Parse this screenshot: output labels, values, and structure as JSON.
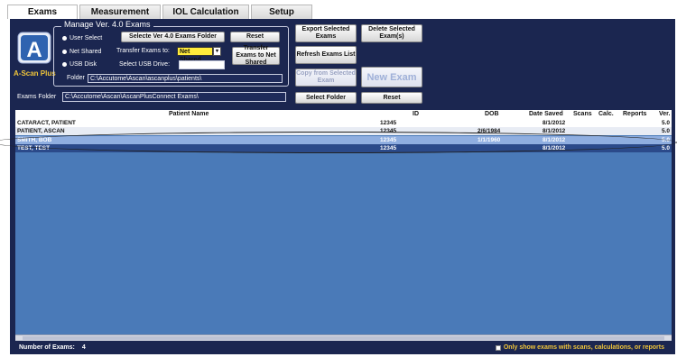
{
  "tabs": [
    "Exams",
    "Measurement",
    "IOL Calculation",
    "Setup"
  ],
  "logo": {
    "label": "A-Scan Plus"
  },
  "manage": {
    "title": "Manage Ver. 4.0 Exams",
    "user_select": "User Select",
    "net_shared": "Net Shared",
    "usb_disk": "USB Disk",
    "select_folder_btn": "Selecte Ver 4.0 Exams Folder",
    "reset_btn": "Reset",
    "transfer_label": "Transfer Exams to:",
    "transfer_value": "Net Shared",
    "transfer_btn": "Transfer Exams to Net Shared",
    "usb_label": "Select USB Drive:",
    "folder_label": "Folder",
    "folder_value": "C:\\Accutome\\Ascan\\ascanplus\\patients\\"
  },
  "actions": {
    "export": "Export Selected Exams",
    "delete": "Delete Selected Exam(s)",
    "refresh": "Refresh Exams List",
    "copy": "Copy from Selected Exam",
    "new_exam": "New Exam"
  },
  "exams_folder": {
    "label": "Exams Folder",
    "value": "C:\\Accutome\\Ascan\\AscanPlusConnect Exams\\",
    "select_btn": "Select Folder",
    "reset_btn": "Reset"
  },
  "table": {
    "headers": [
      "Patient Name",
      "ID",
      "DOB",
      "Date Saved",
      "Scans",
      "Calc.",
      "Reports",
      "Ver."
    ],
    "rows": [
      {
        "name": "CATARACT, PATIENT",
        "id": "12345",
        "dob": "",
        "date": "8/1/2012",
        "ver": "5.0"
      },
      {
        "name": "PATIENT, ASCAN",
        "id": "12345",
        "dob": "2/6/1984",
        "date": "8/1/2012",
        "ver": "5.0"
      },
      {
        "name": "SMITH, BOB",
        "id": "12345",
        "dob": "1/1/1960",
        "date": "8/1/2012",
        "ver": "5.0"
      },
      {
        "name": "TEST, TEST",
        "id": "12345",
        "dob": "",
        "date": "8/1/2012",
        "ver": "5.0"
      }
    ]
  },
  "footer": {
    "count_label": "Number of Exams:",
    "count": "4",
    "filter_label": "Only show exams with scans, calculations, or reports"
  }
}
